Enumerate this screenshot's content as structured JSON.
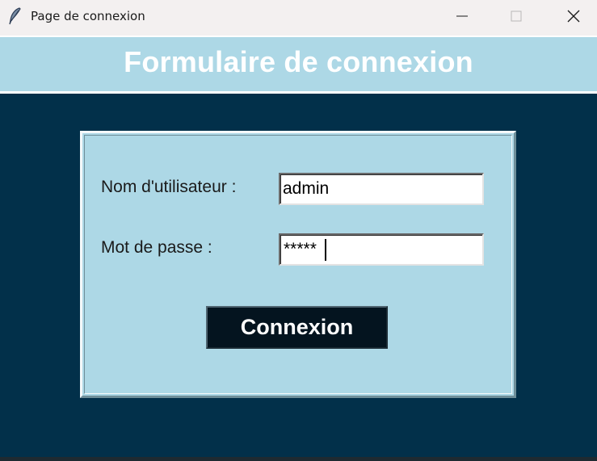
{
  "window": {
    "title": "Page de connexion",
    "app_icon": "feather-icon",
    "controls": {
      "minimize_icon": "minimize-icon",
      "maximize_icon": "maximize-icon",
      "close_icon": "close-icon"
    }
  },
  "header": {
    "title": "Formulaire de connexion"
  },
  "form": {
    "username_label": "Nom d'utilisateur :",
    "username_value": "admin",
    "password_label": "Mot de passe :",
    "password_value": "*****",
    "submit_label": "Connexion"
  },
  "colors": {
    "background": "#02304a",
    "panel": "#add8e6",
    "button": "#04141f",
    "title_text": "#ffffff"
  }
}
